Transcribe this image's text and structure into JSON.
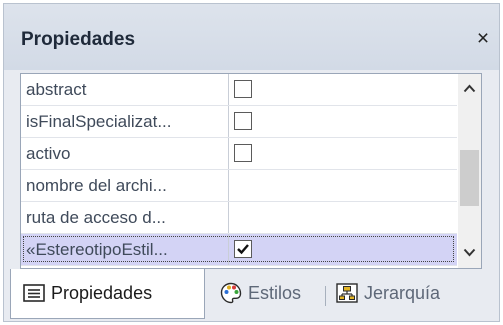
{
  "panel": {
    "title": "Propiedades",
    "close_glyph": "×"
  },
  "properties": [
    {
      "name": "abstract",
      "value_type": "checkbox",
      "checked": false,
      "selected": false
    },
    {
      "name": "isFinalSpecializat...",
      "value_type": "checkbox",
      "checked": false,
      "selected": false
    },
    {
      "name": "activo",
      "value_type": "checkbox",
      "checked": false,
      "selected": false
    },
    {
      "name": "nombre del archi...",
      "value_type": "text",
      "value": "",
      "selected": false
    },
    {
      "name": "ruta de acceso d...",
      "value_type": "text",
      "value": "",
      "selected": false
    },
    {
      "name": "«EstereotipoEstil...",
      "value_type": "checkbox",
      "checked": true,
      "selected": true
    }
  ],
  "scrollbar": {
    "up_icon": "chevron-up-icon",
    "down_icon": "chevron-down-icon"
  },
  "tabs": [
    {
      "label": "Propiedades",
      "icon": "properties-list-icon",
      "active": true
    },
    {
      "label": "Estilos",
      "icon": "palette-icon",
      "active": false
    },
    {
      "label": "Jerarquía",
      "icon": "hierarchy-icon",
      "active": false
    }
  ],
  "colors": {
    "selection": "#d3d3f5",
    "panel_background": "#e8ebf1",
    "title_text": "#1f2a3a",
    "property_text": "#3f4a5a"
  }
}
